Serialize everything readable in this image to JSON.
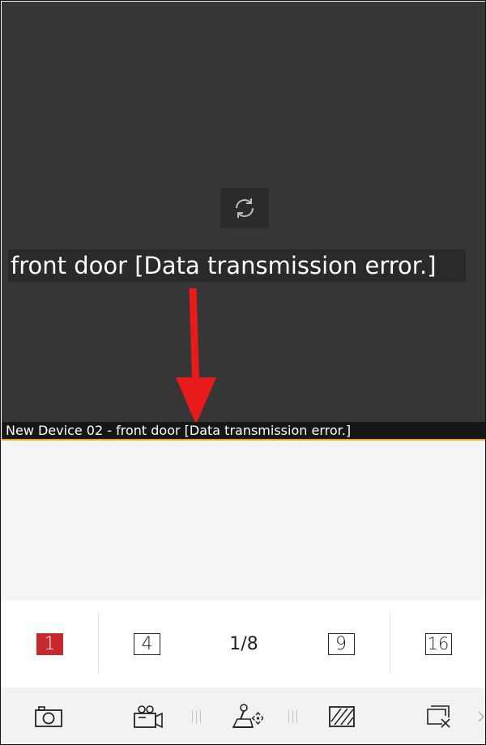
{
  "video": {
    "overlay_text": "front door [Data transmission error.]",
    "caption": "New Device 02 - front door [Data transmission error.]"
  },
  "layout_bar": {
    "options": [
      {
        "label": "1",
        "active": true
      },
      {
        "label": "4",
        "active": false
      },
      {
        "label": "1/8",
        "active": false
      },
      {
        "label": "9",
        "active": false
      },
      {
        "label": "16",
        "active": false
      }
    ]
  },
  "toolbar": {
    "items": [
      "camera-icon",
      "video-record-icon",
      "ptz-joystick-icon",
      "image-quality-icon",
      "close-window-icon",
      "chevron-right-icon"
    ]
  },
  "colors": {
    "video_bg": "#363636",
    "accent_line": "#e6a316",
    "active_layout": "#c8282c",
    "arrow": "#e81a1a"
  }
}
